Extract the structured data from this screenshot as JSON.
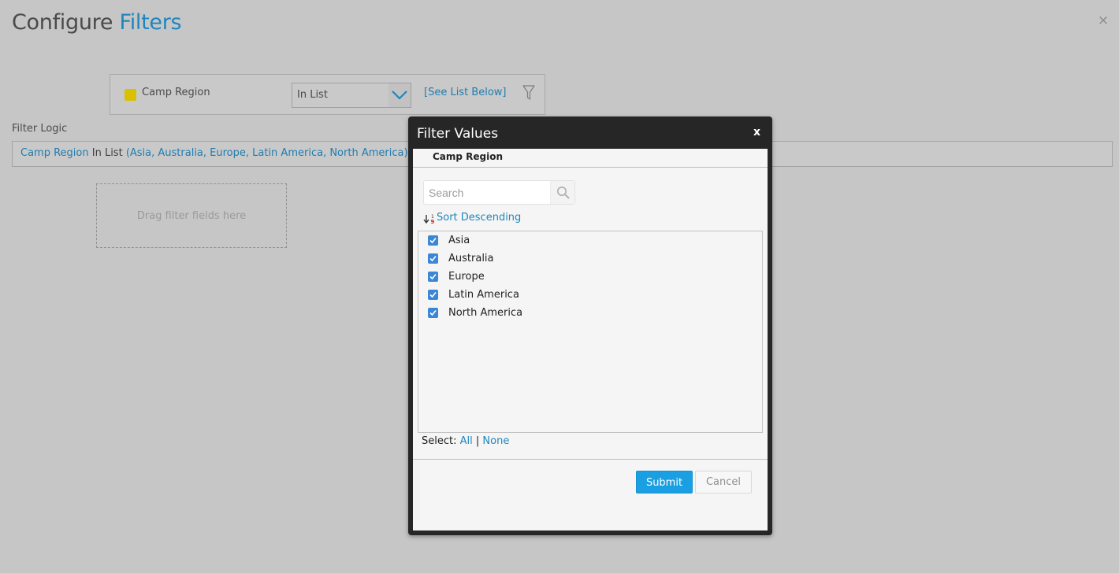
{
  "page": {
    "title_prefix": "Configure",
    "title_accent": "Filters",
    "close_glyph": "×"
  },
  "filter_row": {
    "field_name": "Camp Region",
    "swatch_color": "#d8c100",
    "operator": "In List",
    "value_link": "[See List Below]"
  },
  "filter_logic": {
    "label": "Filter Logic",
    "field": "Camp Region",
    "operator": " In List ",
    "values": "(Asia, Australia, Europe, Latin America, North America)"
  },
  "drop_zone": {
    "text": "Drag filter fields here"
  },
  "modal": {
    "title": "Filter Values",
    "close_label": "x",
    "field_header": "Camp Region",
    "search_placeholder": "Search",
    "sort_label": "Sort Descending",
    "items": [
      {
        "label": "Asia",
        "checked": true
      },
      {
        "label": "Australia",
        "checked": true
      },
      {
        "label": "Europe",
        "checked": true
      },
      {
        "label": "Latin America",
        "checked": true
      },
      {
        "label": "North America",
        "checked": true
      }
    ],
    "select_label": "Select:",
    "select_all": "All",
    "select_sep": "|",
    "select_none": "None",
    "submit_label": "Submit",
    "cancel_label": "Cancel"
  },
  "colors": {
    "accent": "#1f86bd",
    "primary_button": "#1a9fe3",
    "checkbox": "#3b87d6"
  }
}
